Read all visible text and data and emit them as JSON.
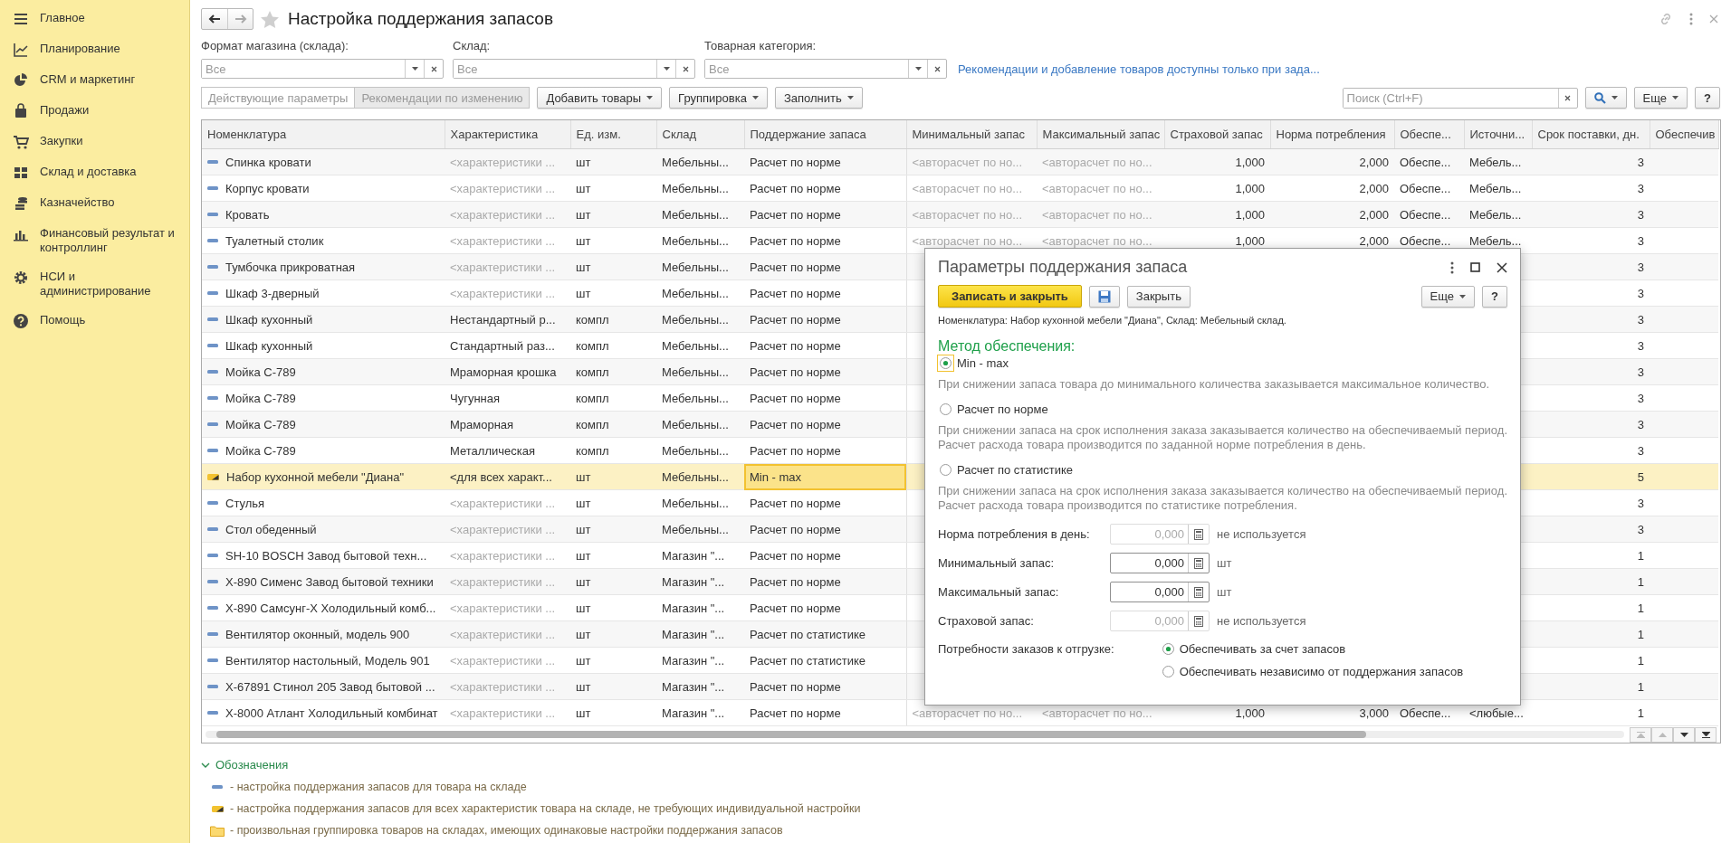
{
  "sidebar": {
    "items": [
      {
        "label": "Главное"
      },
      {
        "label": "Планирование"
      },
      {
        "label": "CRM и маркетинг"
      },
      {
        "label": "Продажи"
      },
      {
        "label": "Закупки"
      },
      {
        "label": "Склад и доставка"
      },
      {
        "label": "Казначейство"
      },
      {
        "label": "Финансовый результат и контроллинг"
      },
      {
        "label": "НСИ и администрирование"
      },
      {
        "label": "Помощь"
      }
    ]
  },
  "page": {
    "title": "Настройка поддержания запасов"
  },
  "filters": [
    {
      "label": "Формат магазина (склада):",
      "placeholder": "Все"
    },
    {
      "label": "Склад:",
      "placeholder": "Все"
    },
    {
      "label": "Товарная категория:",
      "placeholder": "Все"
    }
  ],
  "info_link": "Рекомендации и добавление товаров доступны только при зада...",
  "toolbar": {
    "segments": [
      {
        "label": "Действующие параметры",
        "selected": false
      },
      {
        "label": "Рекомендации по изменению",
        "selected": true
      }
    ],
    "buttons": [
      "Добавить товары",
      "Группировка",
      "Заполнить"
    ],
    "search": {
      "placeholder": "Поиск (Ctrl+F)"
    },
    "more": "Еще",
    "help": "?"
  },
  "table": {
    "columns": [
      "Номенклатура",
      "Характеристика",
      "Ед. изм.",
      "Склад",
      "Поддержание запаса",
      "Минимальный запас",
      "Максимальный запас",
      "Страховой запас",
      "Норма потребления",
      "Обеспе...",
      "Источни...",
      "Срок поставки, дн.",
      "Обеспечив"
    ],
    "rows": [
      {
        "kind": "item",
        "selected": false,
        "name": "Спинка кровати",
        "characteristic": "<характеристики ...",
        "characteristic_placeholder": true,
        "unit": "шт",
        "warehouse": "Мебельны...",
        "method": "Расчет по норме",
        "min_stock": "<авторасчет по но...",
        "max_stock": "<авторасчет по но...",
        "safety_stock": "1,000",
        "consumption_norm": "2,000",
        "provision": "Обеспе...",
        "source": "Мебель...",
        "lead_time": "3"
      },
      {
        "kind": "item",
        "selected": false,
        "name": "Корпус кровати",
        "characteristic": "<характеристики ...",
        "characteristic_placeholder": true,
        "unit": "шт",
        "warehouse": "Мебельны...",
        "method": "Расчет по норме",
        "min_stock": "<авторасчет по но...",
        "max_stock": "<авторасчет по но...",
        "safety_stock": "1,000",
        "consumption_norm": "2,000",
        "provision": "Обеспе...",
        "source": "Мебель...",
        "lead_time": "3"
      },
      {
        "kind": "item",
        "selected": false,
        "name": "Кровать",
        "characteristic": "<характеристики ...",
        "characteristic_placeholder": true,
        "unit": "шт",
        "warehouse": "Мебельны...",
        "method": "Расчет по норме",
        "min_stock": "<авторасчет по но...",
        "max_stock": "<авторасчет по но...",
        "safety_stock": "1,000",
        "consumption_norm": "2,000",
        "provision": "Обеспе...",
        "source": "Мебель...",
        "lead_time": "3"
      },
      {
        "kind": "item",
        "selected": false,
        "name": "Туалетный столик",
        "characteristic": "<характеристики ...",
        "characteristic_placeholder": true,
        "unit": "шт",
        "warehouse": "Мебельны...",
        "method": "Расчет по норме",
        "min_stock": "<авторасчет по но...",
        "max_stock": "<авторасчет по но...",
        "safety_stock": "1,000",
        "consumption_norm": "2,000",
        "provision": "Обеспе...",
        "source": "Мебель...",
        "lead_time": "3"
      },
      {
        "kind": "item",
        "selected": false,
        "name": "Тумбочка прикроватная",
        "characteristic": "<характеристики ...",
        "characteristic_placeholder": true,
        "unit": "шт",
        "warehouse": "Мебельны...",
        "method": "Расчет по норме",
        "lead_time": "3"
      },
      {
        "kind": "item",
        "selected": false,
        "name": "Шкаф 3-дверный",
        "characteristic": "<характеристики ...",
        "characteristic_placeholder": true,
        "unit": "шт",
        "warehouse": "Мебельны...",
        "method": "Расчет по норме",
        "lead_time": "3"
      },
      {
        "kind": "item",
        "selected": false,
        "name": "Шкаф кухонный",
        "characteristic": "Нестандартный р...",
        "characteristic_placeholder": false,
        "unit": "компл",
        "warehouse": "Мебельны...",
        "method": "Расчет по норме",
        "lead_time": "3"
      },
      {
        "kind": "item",
        "selected": false,
        "name": "Шкаф кухонный",
        "characteristic": "Стандартный раз...",
        "characteristic_placeholder": false,
        "unit": "компл",
        "warehouse": "Мебельны...",
        "method": "Расчет по норме",
        "lead_time": "3"
      },
      {
        "kind": "item",
        "selected": false,
        "name": "Мойка С-789",
        "characteristic": "Мраморная крошка",
        "characteristic_placeholder": false,
        "unit": "компл",
        "warehouse": "Мебельны...",
        "method": "Расчет по норме",
        "lead_time": "3"
      },
      {
        "kind": "item",
        "selected": false,
        "name": "Мойка С-789",
        "characteristic": "Чугунная",
        "characteristic_placeholder": false,
        "unit": "компл",
        "warehouse": "Мебельны...",
        "method": "Расчет по норме",
        "lead_time": "3"
      },
      {
        "kind": "item",
        "selected": false,
        "name": "Мойка С-789",
        "characteristic": "Мраморная",
        "characteristic_placeholder": false,
        "unit": "компл",
        "warehouse": "Мебельны...",
        "method": "Расчет по норме",
        "lead_time": "3"
      },
      {
        "kind": "item",
        "selected": false,
        "name": "Мойка С-789",
        "characteristic": "Металлическая",
        "characteristic_placeholder": false,
        "unit": "компл",
        "warehouse": "Мебельны...",
        "method": "Расчет по норме",
        "lead_time": "3"
      },
      {
        "kind": "all_characteristics",
        "selected": true,
        "name": "Набор кухонной мебели \"Диана\"",
        "characteristic": "<для всех характ...",
        "characteristic_placeholder": false,
        "unit": "шт",
        "warehouse": "Мебельны...",
        "method": "Min - max",
        "lead_time": "5"
      },
      {
        "kind": "item",
        "selected": false,
        "name": "Стулья",
        "characteristic": "<характеристики ...",
        "characteristic_placeholder": true,
        "unit": "шт",
        "warehouse": "Мебельны...",
        "method": "Расчет по норме",
        "lead_time": "3"
      },
      {
        "kind": "item",
        "selected": false,
        "name": "Стол обеденный",
        "characteristic": "<характеристики ...",
        "characteristic_placeholder": true,
        "unit": "шт",
        "warehouse": "Мебельны...",
        "method": "Расчет по норме",
        "lead_time": "3"
      },
      {
        "kind": "item",
        "selected": false,
        "name": "SH-10 BOSCH Завод бытовой техн...",
        "characteristic": "<характеристики ...",
        "characteristic_placeholder": true,
        "unit": "шт",
        "warehouse": "Магазин \"...",
        "method": "Расчет по норме",
        "lead_time": "1"
      },
      {
        "kind": "item",
        "selected": false,
        "name": "X-890 Сименс Завод бытовой техники",
        "characteristic": "<характеристики ...",
        "characteristic_placeholder": true,
        "unit": "шт",
        "warehouse": "Магазин \"...",
        "method": "Расчет по норме",
        "lead_time": "1"
      },
      {
        "kind": "item",
        "selected": false,
        "name": "X-890 Самсунг-Х Холодильный комб...",
        "characteristic": "<характеристики ...",
        "characteristic_placeholder": true,
        "unit": "шт",
        "warehouse": "Магазин \"...",
        "method": "Расчет по норме",
        "lead_time": "1"
      },
      {
        "kind": "item",
        "selected": false,
        "name": "Вентилятор оконный, модель 900",
        "characteristic": "<характеристики ...",
        "characteristic_placeholder": true,
        "unit": "шт",
        "warehouse": "Магазин \"...",
        "method": "Расчет по статистике",
        "lead_time": "1"
      },
      {
        "kind": "item",
        "selected": false,
        "name": "Вентилятор настольный, Модель 901",
        "characteristic": "<характеристики ...",
        "characteristic_placeholder": true,
        "unit": "шт",
        "warehouse": "Магазин \"...",
        "method": "Расчет по статистике",
        "lead_time": "1"
      },
      {
        "kind": "item",
        "selected": false,
        "name": "X-67891 Стинол 205 Завод бытовой ...",
        "characteristic": "<характеристики ...",
        "characteristic_placeholder": true,
        "unit": "шт",
        "warehouse": "Магазин \"...",
        "method": "Расчет по норме",
        "lead_time": "1"
      },
      {
        "kind": "item",
        "selected": false,
        "name": "X-8000 Атлант Холодильный комбинат",
        "characteristic": "<характеристики ...",
        "characteristic_placeholder": true,
        "unit": "шт",
        "warehouse": "Магазин \"...",
        "method": "Расчет по норме",
        "min_stock": "<авторасчет по но...",
        "max_stock": "<авторасчет по но...",
        "safety_stock": "1,000",
        "consumption_norm": "3,000",
        "provision": "Обеспе...",
        "source": "<любые...",
        "lead_time": "1"
      }
    ]
  },
  "legend": {
    "title": "Обозначения",
    "expanded": true,
    "items": [
      {
        "kind": "item",
        "text": "- настройка поддержания запасов для товара на складе"
      },
      {
        "kind": "all_characteristics",
        "text": "- настройка поддержания запасов для всех характеристик товара на складе, не требующих индивидуальной настройки"
      },
      {
        "kind": "group",
        "text": "- произвольная группировка товаров на складах, имеющих одинаковые настройки поддержания запасов"
      }
    ]
  },
  "dialog": {
    "title": "Параметры поддержания запаса",
    "save_close": "Записать и закрыть",
    "close": "Закрыть",
    "more": "Еще",
    "help": "?",
    "info": "Номенклатура: Набор кухонной мебели \"Диана\", Склад: Мебельный склад.",
    "method_title": "Метод обеспечения:",
    "methods": [
      {
        "label": "Min - max",
        "selected": true,
        "description": "При снижении запаса товара до минимального количества заказывается максимальное количество."
      },
      {
        "label": "Расчет по норме",
        "selected": false,
        "description": "При снижении запаса на срок исполнения заказа заказывается количество на обеспечиваемый период. Расчет расхода товара производится по заданной норме потребления в день."
      },
      {
        "label": "Расчет по статистике",
        "selected": false,
        "description": "При снижении запаса на срок исполнения заказа заказывается количество на обеспечиваемый период. Расчет расхода товара производится по статистике потребления."
      }
    ],
    "fields": [
      {
        "label": "Норма потребления в день:",
        "value": "0,000",
        "disabled": true,
        "unit": "не используется"
      },
      {
        "label": "Минимальный запас:",
        "value": "0,000",
        "disabled": false,
        "unit": "шт"
      },
      {
        "label": "Максимальный запас:",
        "value": "0,000",
        "disabled": false,
        "unit": "шт"
      },
      {
        "label": "Страховой запас:",
        "value": "0,000",
        "disabled": true,
        "unit": "не используется"
      }
    ],
    "orders": {
      "label": "Потребности заказов к отгрузке:",
      "options": [
        {
          "label": "Обеспечивать за счет запасов",
          "selected": true
        },
        {
          "label": "Обеспечивать независимо от поддержания запасов",
          "selected": false
        }
      ]
    }
  }
}
